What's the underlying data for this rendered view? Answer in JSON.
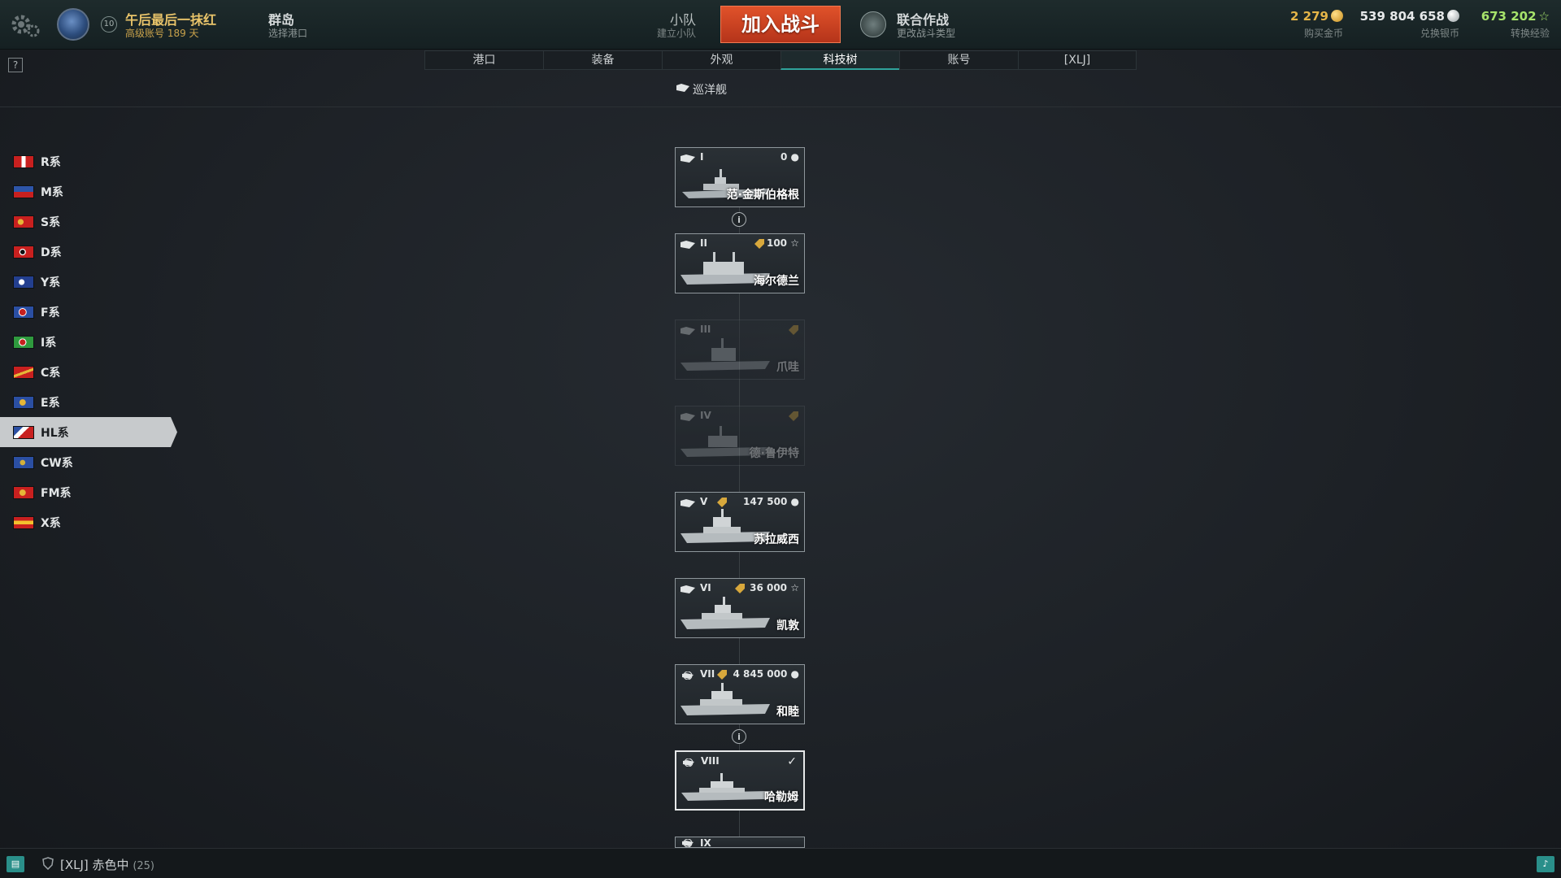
{
  "topbar": {
    "player_name": "午后最后一抹红",
    "player_sub": "高级账号 189 天",
    "player_level": "10",
    "port_name": "群岛",
    "port_sub": "选择港口",
    "squad_label": "小队",
    "squad_sub": "建立小队",
    "battle_button": "加入战斗",
    "mode_name": "联合作战",
    "mode_sub": "更改战斗类型",
    "gold_value": "2 279",
    "gold_label": "购买金币",
    "silver_value": "539 804 658",
    "silver_label": "兑换银币",
    "xp_value": "673 202",
    "xp_label": "转换经验",
    "colors": {
      "gold": "#e5b548",
      "silver": "#e6e8e9",
      "xp": "#a7e36b",
      "battle": "#d44a22"
    }
  },
  "help_label": "?",
  "tabs": [
    {
      "label": "港口",
      "active": false
    },
    {
      "label": "装备",
      "active": false
    },
    {
      "label": "外观",
      "active": false
    },
    {
      "label": "科技树",
      "active": true
    },
    {
      "label": "账号",
      "active": false
    },
    {
      "label": "[XLJ]",
      "active": false
    }
  ],
  "ship_class": "巡洋舰",
  "nations": [
    {
      "label": "R系",
      "flag": [
        "#c8201f",
        "#ffffff"
      ]
    },
    {
      "label": "M系",
      "flag": [
        "#2d55a8",
        "#c8201f"
      ]
    },
    {
      "label": "S系",
      "flag": [
        "#c8201f",
        "#e6b637"
      ]
    },
    {
      "label": "D系",
      "flag": [
        "#c8201f",
        "#111111"
      ]
    },
    {
      "label": "Y系",
      "flag": [
        "#233f8f",
        "#ffffff"
      ]
    },
    {
      "label": "F系",
      "flag": [
        "#2b4fa3",
        "#c8201f"
      ]
    },
    {
      "label": "I系",
      "flag": [
        "#2f9a3e",
        "#c8201f"
      ]
    },
    {
      "label": "C系",
      "flag": [
        "#c8201f",
        "#e6b637"
      ]
    },
    {
      "label": "E系",
      "flag": [
        "#2b4fa3",
        "#e6b637"
      ]
    },
    {
      "label": "HL系",
      "flag": [
        "#ffffff",
        "#c8201f"
      ],
      "active": true
    },
    {
      "label": "CW系",
      "flag": [
        "#2b4fa3",
        "#d3b13a"
      ]
    },
    {
      "label": "FM系",
      "flag": [
        "#c8201f",
        "#e6b637"
      ]
    },
    {
      "label": "X系",
      "flag": [
        "#c8201f",
        "#f2c12e"
      ]
    }
  ],
  "ships": [
    {
      "tier": "I",
      "cost": "0",
      "currency": "silver",
      "name": "范·金斯伯格根",
      "state": "normal"
    },
    {
      "tier": "II",
      "cost": "100",
      "currency": "xp",
      "name": "海尔德兰",
      "state": "normal",
      "tag": true
    },
    {
      "tier": "III",
      "cost": "",
      "currency": "",
      "name": "爪哇",
      "state": "dim",
      "tag": true
    },
    {
      "tier": "IV",
      "cost": "",
      "currency": "",
      "name": "德·鲁伊特",
      "state": "dim",
      "tag": true
    },
    {
      "tier": "V",
      "cost": "147 500",
      "currency": "silver",
      "name": "苏拉威西",
      "state": "normal",
      "tag": true
    },
    {
      "tier": "VI",
      "cost": "36 000",
      "currency": "xp",
      "name": "凯敦",
      "state": "normal",
      "tag": true
    },
    {
      "tier": "VII",
      "cost": "4 845 000",
      "currency": "silver",
      "name": "和睦",
      "state": "normal",
      "tag": true,
      "elite": true
    },
    {
      "tier": "VIII",
      "cost": "",
      "currency": "",
      "name": "哈勒姆",
      "state": "owned",
      "elite": true
    },
    {
      "tier": "IX",
      "cost": "",
      "currency": "",
      "name": "",
      "state": "partial"
    }
  ],
  "info_icon": "i",
  "bottombar": {
    "chat_icon": "chat-icon",
    "clan_text": "[XLJ]  赤色中",
    "clan_count": "(25)",
    "bell_icon": "bell-icon"
  }
}
